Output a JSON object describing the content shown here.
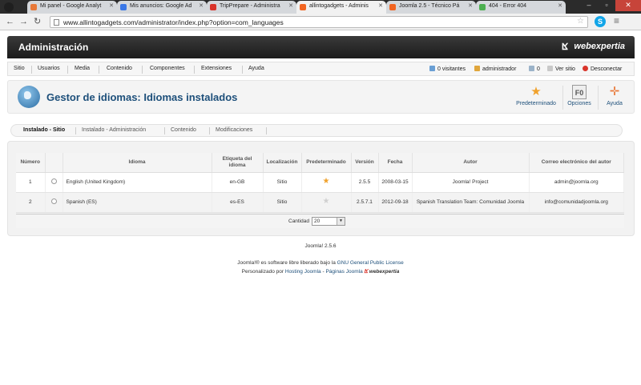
{
  "browser": {
    "tabs": [
      {
        "label": "Mi panel - Google Analyt",
        "favicon_color": "#e8793a"
      },
      {
        "label": "Mis anuncios: Google Ad",
        "favicon_color": "#3b78e7"
      },
      {
        "label": "TripPrepare - Administra",
        "favicon_color": "#d9342b"
      },
      {
        "label": "allintogadgets - Adminis",
        "favicon_color": "#f26522"
      },
      {
        "label": "Joomla 2.5 - Técnico Pá",
        "favicon_color": "#f26522"
      },
      {
        "label": "404 - Error 404",
        "favicon_color": "#4caf50"
      }
    ],
    "url": "www.allintogadgets.com/administrator/index.php?option=com_languages"
  },
  "header": {
    "title": "Administración",
    "brand": "webexpertia"
  },
  "menu": {
    "items": [
      "Sitio",
      "Usuarios",
      "Media",
      "Contenido",
      "Componentes",
      "Extensiones",
      "Ayuda"
    ],
    "visitors": "0 visitantes",
    "admin": "administrador",
    "messages": "0",
    "view_site": "Ver sitio",
    "logout": "Desconectar"
  },
  "titlebar": {
    "title": "Gestor de idiomas: Idiomas instalados",
    "buttons": [
      "Predeterminado",
      "Opciones",
      "Ayuda"
    ]
  },
  "subnav": [
    "Instalado - Sitio",
    "Instalado - Administración",
    "Contenido",
    "Modificaciones"
  ],
  "table": {
    "headers": [
      "Número",
      "",
      "Idioma",
      "Etiqueta del idioma",
      "Localización",
      "Predeterminado",
      "Versión",
      "Fecha",
      "Autor",
      "Correo electrónico del autor"
    ],
    "rows": [
      {
        "num": "1",
        "language": "English (United Kingdom)",
        "tag": "en-GB",
        "location": "Sitio",
        "default": true,
        "version": "2.5.5",
        "date": "2008-03-15",
        "author": "Joomla! Project",
        "email": "admin@joomla.org"
      },
      {
        "num": "2",
        "language": "Spanish (ES)",
        "tag": "es-ES",
        "location": "Sitio",
        "default": false,
        "version": "2.5.7.1",
        "date": "2012-09-18",
        "author": "Spanish Translation Team: Comunidad Joomla",
        "email": "info@comunidadjoomla.org"
      }
    ],
    "limit_label": "Cantidad",
    "limit_value": "20"
  },
  "footer": {
    "version": "Joomla! 2.5.6",
    "line1_prefix": "Joomla!® es software libre liberado bajo la ",
    "line1_link": "GNU General Public License",
    "line2_prefix": "Personalizado por ",
    "line2_link1": "Hosting Joomla",
    "line2_sep": " - ",
    "line2_link2": "Páginas Joomla",
    "line2_brand": "webexpertia"
  }
}
